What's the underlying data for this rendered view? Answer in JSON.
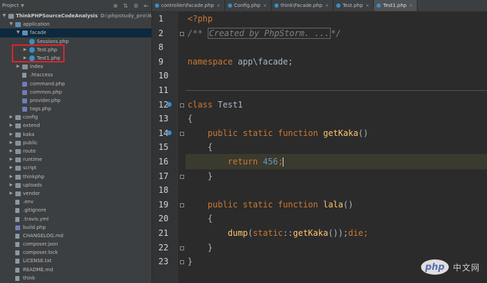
{
  "project_panel": {
    "title": "Project",
    "tree": [
      {
        "label": "ThinkPHPSourceCodeAnalysis",
        "path": "D:\\phpstudy_pro\\WWW\\Th",
        "type": "root",
        "depth": 0,
        "expanded": true
      },
      {
        "label": "application",
        "type": "folder",
        "depth": 1,
        "expanded": true
      },
      {
        "label": "facade",
        "type": "folder",
        "depth": 2,
        "expanded": true,
        "selected": true
      },
      {
        "label": "Sessions.php",
        "type": "class",
        "depth": 3
      },
      {
        "label": "Test.php",
        "type": "class",
        "depth": 3,
        "collapsed": true
      },
      {
        "label": "Test1.php",
        "type": "class",
        "depth": 3,
        "collapsed": true
      },
      {
        "label": "index",
        "type": "folder",
        "depth": 2,
        "collapsed": true
      },
      {
        "label": ".htaccess",
        "type": "file",
        "depth": 2
      },
      {
        "label": "command.php",
        "type": "php",
        "depth": 2
      },
      {
        "label": "common.php",
        "type": "php",
        "depth": 2
      },
      {
        "label": "provider.php",
        "type": "php",
        "depth": 2
      },
      {
        "label": "tags.php",
        "type": "php",
        "depth": 2
      },
      {
        "label": "config",
        "type": "folder",
        "depth": 1,
        "collapsed": true
      },
      {
        "label": "extend",
        "type": "folder",
        "depth": 1,
        "collapsed": true
      },
      {
        "label": "kaka",
        "type": "folder",
        "depth": 1,
        "collapsed": true
      },
      {
        "label": "public",
        "type": "folder",
        "depth": 1,
        "collapsed": true
      },
      {
        "label": "route",
        "type": "folder",
        "depth": 1,
        "collapsed": true
      },
      {
        "label": "runtime",
        "type": "folder",
        "depth": 1,
        "collapsed": true
      },
      {
        "label": "script",
        "type": "folder",
        "depth": 1,
        "collapsed": true
      },
      {
        "label": "thinkphp",
        "type": "folder",
        "depth": 1,
        "collapsed": true
      },
      {
        "label": "uploads",
        "type": "folder",
        "depth": 1,
        "collapsed": true
      },
      {
        "label": "vendor",
        "type": "folder",
        "depth": 1,
        "collapsed": true
      },
      {
        "label": ".env",
        "type": "file",
        "depth": 1
      },
      {
        "label": ".gitignore",
        "type": "file",
        "depth": 1
      },
      {
        "label": ".travis.yml",
        "type": "file",
        "depth": 1
      },
      {
        "label": "build.php",
        "type": "php",
        "depth": 1
      },
      {
        "label": "CHANGELOG.md",
        "type": "file",
        "depth": 1
      },
      {
        "label": "composer.json",
        "type": "file",
        "depth": 1
      },
      {
        "label": "composer.lock",
        "type": "file",
        "depth": 1
      },
      {
        "label": "LICENSE.txt",
        "type": "file",
        "depth": 1
      },
      {
        "label": "README.md",
        "type": "file",
        "depth": 1
      },
      {
        "label": "think",
        "type": "file",
        "depth": 1
      }
    ]
  },
  "tabs": [
    {
      "label": "controller\\Facade.php",
      "active": false
    },
    {
      "label": "Config.php",
      "active": false
    },
    {
      "label": "think\\Facade.php",
      "active": false
    },
    {
      "label": "Test.php",
      "active": false
    },
    {
      "label": "Test1.php",
      "active": true
    }
  ],
  "editor": {
    "lines": [
      {
        "num": "1",
        "tokens": [
          {
            "t": "<?php",
            "c": "kw"
          }
        ]
      },
      {
        "num": "2",
        "tokens": [
          {
            "t": "/** ",
            "c": "cmt"
          },
          {
            "t": "Created by PhpStorm. ...",
            "c": "cmt-box"
          },
          {
            "t": "*/",
            "c": "cmt"
          }
        ]
      },
      {
        "num": "8",
        "tokens": []
      },
      {
        "num": "9",
        "tokens": [
          {
            "t": "namespace",
            "c": "kw"
          },
          {
            "t": " app\\facade;",
            "c": ""
          }
        ]
      },
      {
        "num": "10",
        "tokens": []
      },
      {
        "num": "11",
        "tokens": []
      },
      {
        "num": "12",
        "tokens": [
          {
            "t": "class",
            "c": "kw"
          },
          {
            "t": " Test1",
            "c": ""
          }
        ]
      },
      {
        "num": "13",
        "tokens": [
          {
            "t": "{",
            "c": ""
          }
        ]
      },
      {
        "num": "14",
        "tokens": [
          {
            "t": "    ",
            "c": ""
          },
          {
            "t": "public static function",
            "c": "kw"
          },
          {
            "t": " ",
            "c": ""
          },
          {
            "t": "getKaka",
            "c": "fn"
          },
          {
            "t": "()",
            "c": ""
          }
        ]
      },
      {
        "num": "15",
        "tokens": [
          {
            "t": "    {",
            "c": ""
          }
        ]
      },
      {
        "num": "16",
        "tokens": [
          {
            "t": "        ",
            "c": ""
          },
          {
            "t": "return",
            "c": "kw"
          },
          {
            "t": " ",
            "c": ""
          },
          {
            "t": "456",
            "c": "num"
          },
          {
            "t": ";",
            "c": "kw"
          }
        ]
      },
      {
        "num": "17",
        "tokens": [
          {
            "t": "    }",
            "c": ""
          }
        ]
      },
      {
        "num": "18",
        "tokens": []
      },
      {
        "num": "19",
        "tokens": [
          {
            "t": "    ",
            "c": ""
          },
          {
            "t": "public static function",
            "c": "kw"
          },
          {
            "t": " ",
            "c": ""
          },
          {
            "t": "lala",
            "c": "fn"
          },
          {
            "t": "()",
            "c": ""
          }
        ]
      },
      {
        "num": "20",
        "tokens": [
          {
            "t": "    {",
            "c": ""
          }
        ]
      },
      {
        "num": "21",
        "tokens": [
          {
            "t": "        ",
            "c": ""
          },
          {
            "t": "dump",
            "c": "fn"
          },
          {
            "t": "(",
            "c": ""
          },
          {
            "t": "static",
            "c": "kw"
          },
          {
            "t": "::",
            "c": ""
          },
          {
            "t": "getKaka",
            "c": "fn"
          },
          {
            "t": "());",
            "c": ""
          },
          {
            "t": "die",
            "c": "kw"
          },
          {
            "t": ";",
            "c": "kw"
          }
        ]
      },
      {
        "num": "22",
        "tokens": [
          {
            "t": "    }",
            "c": ""
          }
        ]
      },
      {
        "num": "23",
        "tokens": [
          {
            "t": "}",
            "c": ""
          }
        ]
      }
    ]
  },
  "watermark": {
    "logo": "php",
    "text": "中文网"
  },
  "colors": {
    "keyword": "#cc7832",
    "function": "#ffc66d",
    "number": "#6897bb",
    "highlight_box": "#e0232a"
  }
}
